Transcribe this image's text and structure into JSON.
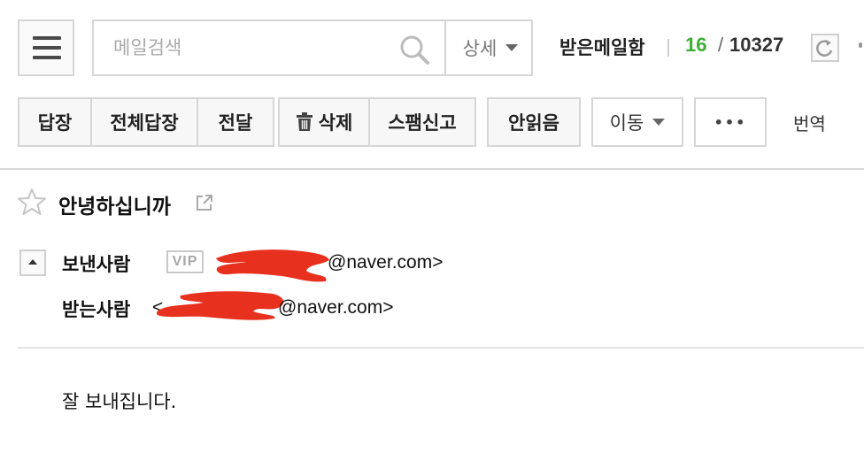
{
  "search": {
    "placeholder": "메일검색",
    "detail_label": "상세"
  },
  "mailbox": {
    "name": "받은메일함",
    "unread": "16",
    "separator": "/",
    "total": "10327"
  },
  "toolbar": {
    "reply": "답장",
    "reply_all": "전체답장",
    "forward": "전달",
    "delete": "삭제",
    "spam": "스팸신고",
    "unread": "안읽음",
    "move": "이동",
    "more": "•••",
    "translate": "번역"
  },
  "mail": {
    "subject": "안녕하십니까",
    "sender_label": "보낸사람",
    "vip_badge": "VIP",
    "sender_address_suffix": "@naver.com>",
    "recipient_label": "받는사람",
    "recipient_address_prefix": "<",
    "recipient_address_suffix": "@naver.com>",
    "body": "잘 보내집니다."
  },
  "colors": {
    "unread_count": "#3dae33",
    "redaction": "#e8301f",
    "border": "#d6d6d6"
  },
  "icons": [
    "menu-icon",
    "search-icon",
    "chevron-down-icon",
    "refresh-icon",
    "trash-icon",
    "star-icon",
    "popout-icon",
    "collapse-icon"
  ]
}
